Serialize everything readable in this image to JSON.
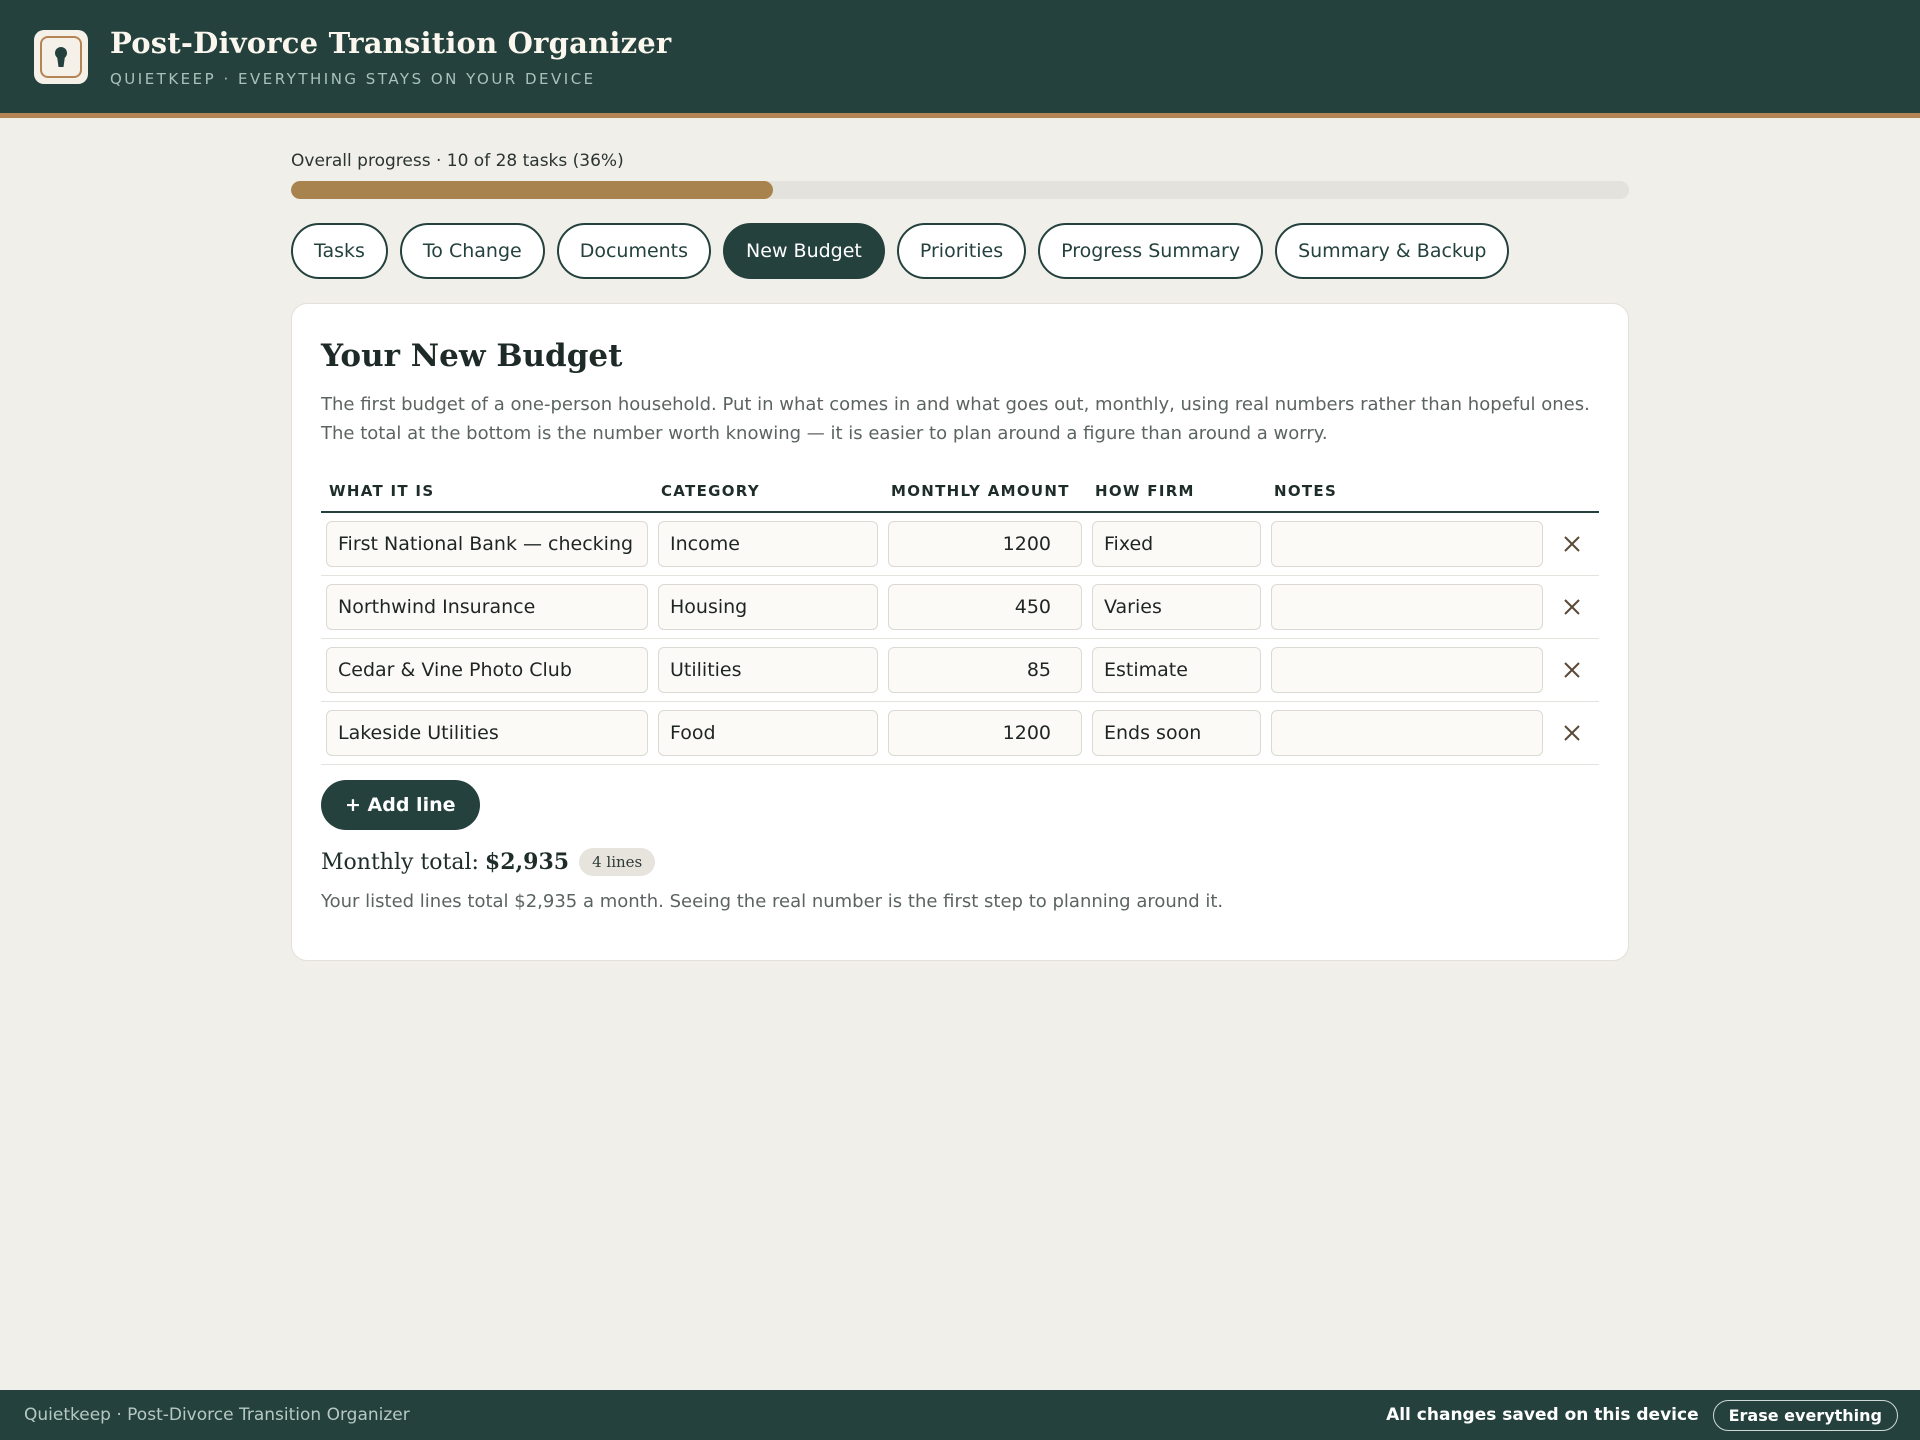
{
  "header": {
    "title": "Post-Divorce Transition Organizer",
    "subtitle": "QUIETKEEP · EVERYTHING STAYS ON YOUR DEVICE",
    "logo_icon": "keyhole-icon"
  },
  "progress": {
    "label": "Overall progress · 10 of 28 tasks (36%)",
    "completed": 10,
    "total": 28,
    "percent": 36
  },
  "tabs": [
    {
      "label": "Tasks",
      "active": false
    },
    {
      "label": "To Change",
      "active": false
    },
    {
      "label": "Documents",
      "active": false
    },
    {
      "label": "New Budget",
      "active": true
    },
    {
      "label": "Priorities",
      "active": false
    },
    {
      "label": "Progress Summary",
      "active": false
    },
    {
      "label": "Summary & Backup",
      "active": false
    }
  ],
  "budget": {
    "title": "Your New Budget",
    "description": "The first budget of a one-person household. Put in what comes in and what goes out, monthly, using real numbers rather than hopeful ones. The total at the bottom is the number worth knowing — it is easier to plan around a figure than around a worry.",
    "columns": [
      "WHAT IT IS",
      "CATEGORY",
      "MONTHLY AMOUNT",
      "HOW FIRM",
      "NOTES"
    ],
    "rows": [
      {
        "what": "First National Bank — checking",
        "category": "Income",
        "amount": "1200",
        "firm": "Fixed",
        "notes": ""
      },
      {
        "what": "Northwind Insurance",
        "category": "Housing",
        "amount": "450",
        "firm": "Varies",
        "notes": ""
      },
      {
        "what": "Cedar & Vine Photo Club",
        "category": "Utilities",
        "amount": "85",
        "firm": "Estimate",
        "notes": ""
      },
      {
        "what": "Lakeside Utilities",
        "category": "Food",
        "amount": "1200",
        "firm": "Ends soon",
        "notes": ""
      }
    ],
    "add_label": "+ Add line",
    "total_label": "Monthly total:",
    "total_amount": "$2,935",
    "lines_badge": "4 lines",
    "total_note": "Your listed lines total $2,935 a month. Seeing the real number is the first step to planning around it."
  },
  "footer": {
    "left": "Quietkeep · Post-Divorce Transition Organizer",
    "status": "All changes saved on this device",
    "erase_label": "Erase everything"
  },
  "colors": {
    "primary": "#24413d",
    "accent": "#b58454",
    "progress": "#a8834d",
    "background": "#f1efea"
  }
}
